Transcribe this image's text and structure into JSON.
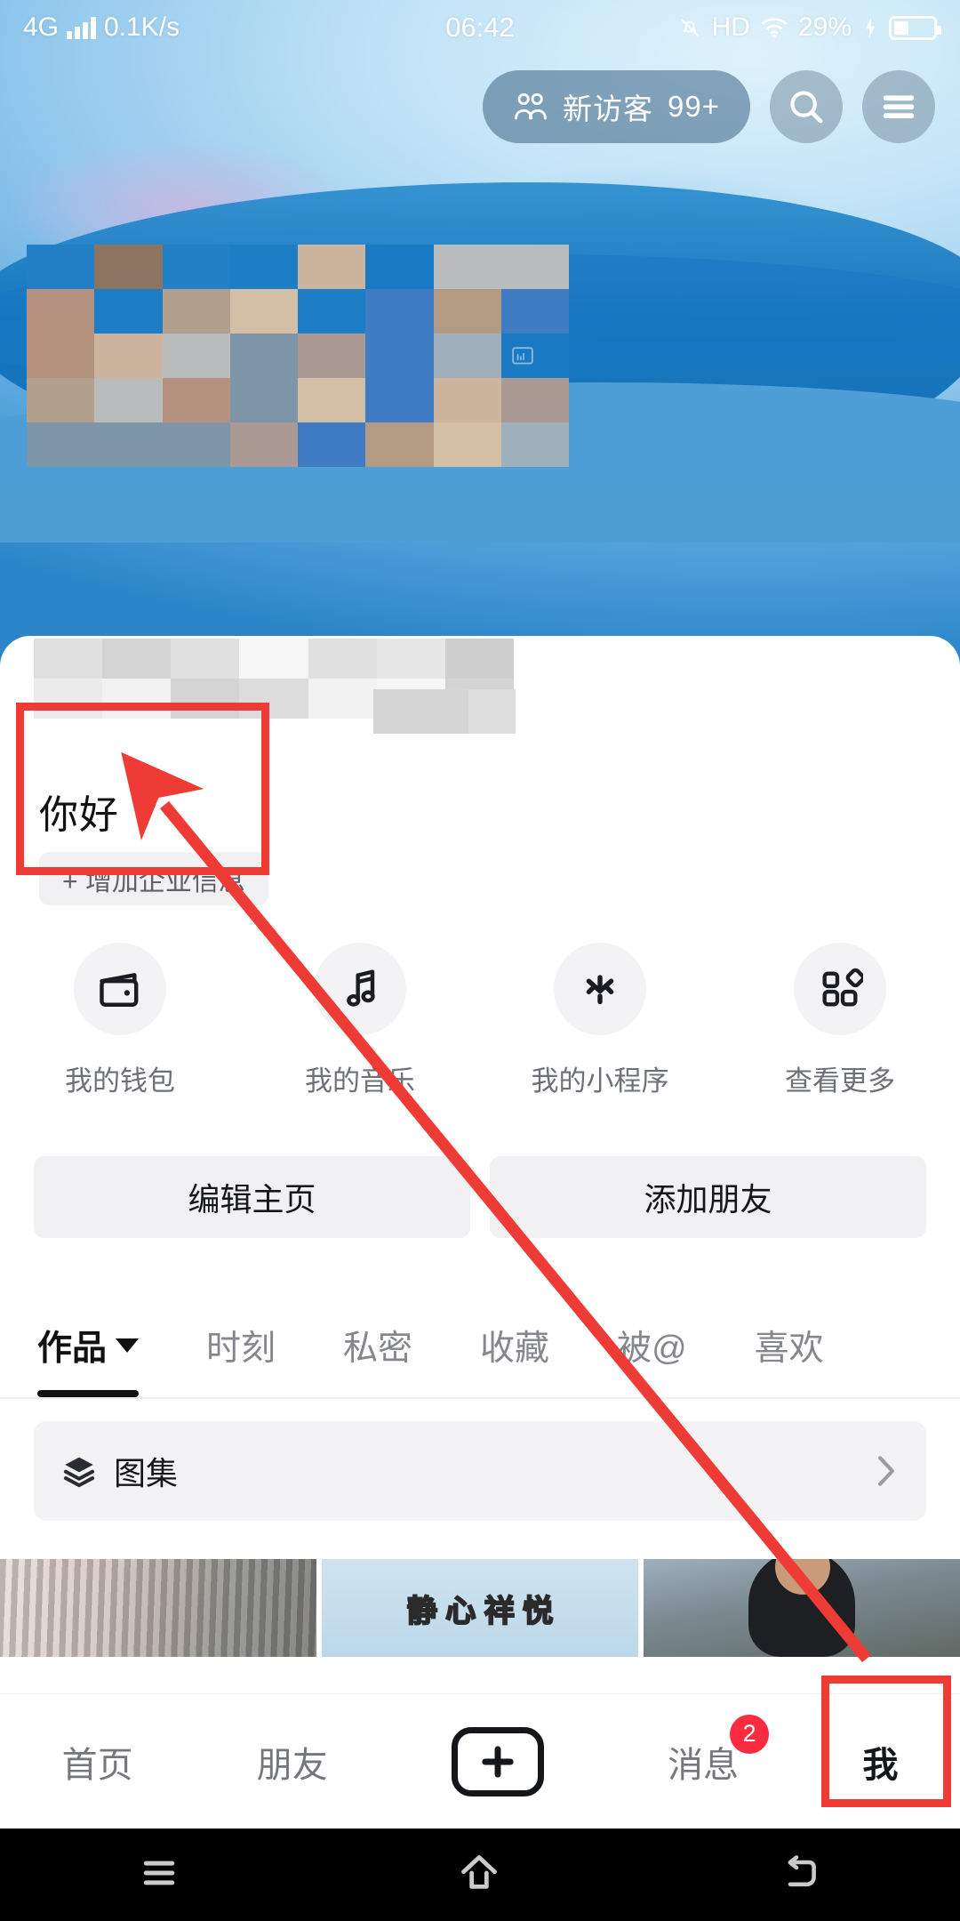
{
  "status_bar": {
    "network": "4G",
    "speed": "0.1K/s",
    "time": "06:42",
    "hd": "HD",
    "battery_percent": "29%",
    "icons": {
      "signal": "signal-bars-icon",
      "mute": "bell-muted-icon",
      "wifi": "wifi-icon",
      "charging": "charging-bolt-icon",
      "battery": "battery-icon"
    }
  },
  "header": {
    "visitor_pill_label": "新访客",
    "visitor_count": "99+",
    "search_icon": "search-icon",
    "menu_icon": "hamburger-menu-icon"
  },
  "profile": {
    "nickname": "你好",
    "business_chip": "+ 增加企业信息"
  },
  "quick_actions": [
    {
      "label": "我的钱包",
      "icon": "wallet-icon"
    },
    {
      "label": "我的音乐",
      "icon": "music-note-icon"
    },
    {
      "label": "我的小程序",
      "icon": "mini-program-icon"
    },
    {
      "label": "查看更多",
      "icon": "grid-more-icon"
    }
  ],
  "action_buttons": {
    "edit_home": "编辑主页",
    "add_friend": "添加朋友"
  },
  "content_tabs": [
    {
      "label": "作品",
      "active": true,
      "has_caret": true
    },
    {
      "label": "时刻",
      "active": false
    },
    {
      "label": "私密",
      "active": false
    },
    {
      "label": "收藏",
      "active": false
    },
    {
      "label": "被@",
      "active": false
    },
    {
      "label": "喜欢",
      "active": false
    }
  ],
  "album_row": {
    "label": "图集",
    "icon": "layers-stack-icon",
    "chevron": "chevron-right-icon"
  },
  "thumbnails": [
    {
      "caption": ""
    },
    {
      "caption": "静 心 祥 悦"
    },
    {
      "caption": ""
    }
  ],
  "bottom_nav": [
    {
      "label": "首页",
      "active": false
    },
    {
      "label": "朋友",
      "active": false
    },
    {
      "label": "",
      "icon": "plus-create-icon",
      "active": false
    },
    {
      "label": "消息",
      "active": false,
      "badge": "2"
    },
    {
      "label": "我",
      "active": true
    }
  ],
  "system_nav": [
    {
      "icon": "recents-icon"
    },
    {
      "icon": "home-icon"
    },
    {
      "icon": "back-icon"
    }
  ],
  "annotations": {
    "color": "#ef3b35",
    "highlight_nickname": "你好",
    "highlight_tab": "我"
  },
  "colors": {
    "annotation_red": "#ef3b35",
    "badge_red": "#fb2b40",
    "text_primary": "#15161a",
    "text_secondary": "#75777d",
    "chip_bg": "#f1f1f3",
    "banner_blue": "#1877c2"
  }
}
